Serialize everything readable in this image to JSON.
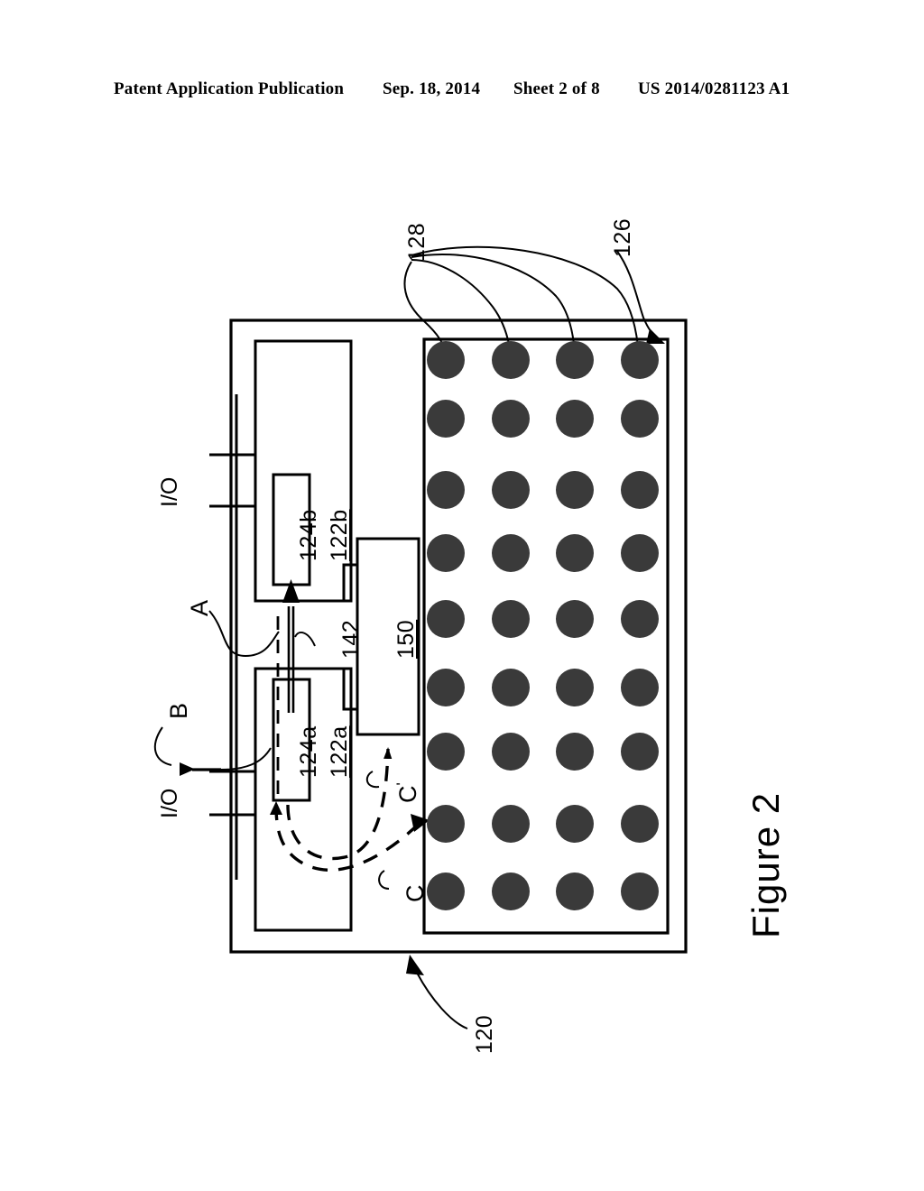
{
  "header": {
    "publication": "Patent Application Publication",
    "date": "Sep. 18, 2014",
    "sheet": "Sheet 2 of 8",
    "patent_number": "US 2014/0281123 A1"
  },
  "figure": {
    "caption": "Figure 2"
  },
  "diagram": {
    "reference_numerals": {
      "device": "120",
      "array_region": "126",
      "array_element": "128",
      "block_a": "122a",
      "block_b": "122b",
      "inner_a": "124a",
      "inner_b": "124b",
      "controller": "150",
      "link": "142"
    },
    "letters": {
      "a": "A",
      "b": "B",
      "c": "C",
      "c_prime": "C",
      "c_prime_mark": "'"
    },
    "io_labels": {
      "top": "I/O",
      "bottom": "I/O"
    },
    "array": {
      "rows": 9,
      "columns": 4,
      "dot_color": "#3a3a3a",
      "dot_radius": 21
    },
    "line_color": "#000000"
  }
}
